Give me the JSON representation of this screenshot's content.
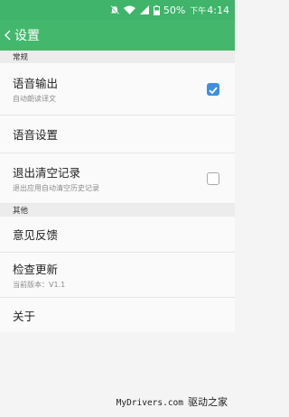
{
  "status_bar": {
    "battery_percent": "50%",
    "time_prefix": "下午",
    "time": "4:14",
    "icons": [
      "mute-icon",
      "wifi-icon",
      "signal-icon",
      "battery-icon"
    ]
  },
  "app_bar": {
    "title": "设置",
    "back_icon": "chevron-left-icon"
  },
  "sections": {
    "general": {
      "header": "常规",
      "voice_output": {
        "label": "语音输出",
        "sub": "自动朗读译文",
        "checked": true
      },
      "voice_settings": {
        "label": "语音设置"
      },
      "clear_history": {
        "label": "退出清空记录",
        "sub": "退出应用自动清空历史记录",
        "checked": false
      }
    },
    "other": {
      "header": "其他",
      "feedback": {
        "label": "意见反馈"
      },
      "check_update": {
        "label": "检查更新",
        "sub": "当前版本：V1.1"
      },
      "about": {
        "label": "关于"
      }
    }
  },
  "watermark": {
    "en": "MyDrivers.com",
    "cn": "驱动之家"
  },
  "colors": {
    "accent_green": "#43b86c",
    "checkbox_blue": "#3d90e0"
  }
}
